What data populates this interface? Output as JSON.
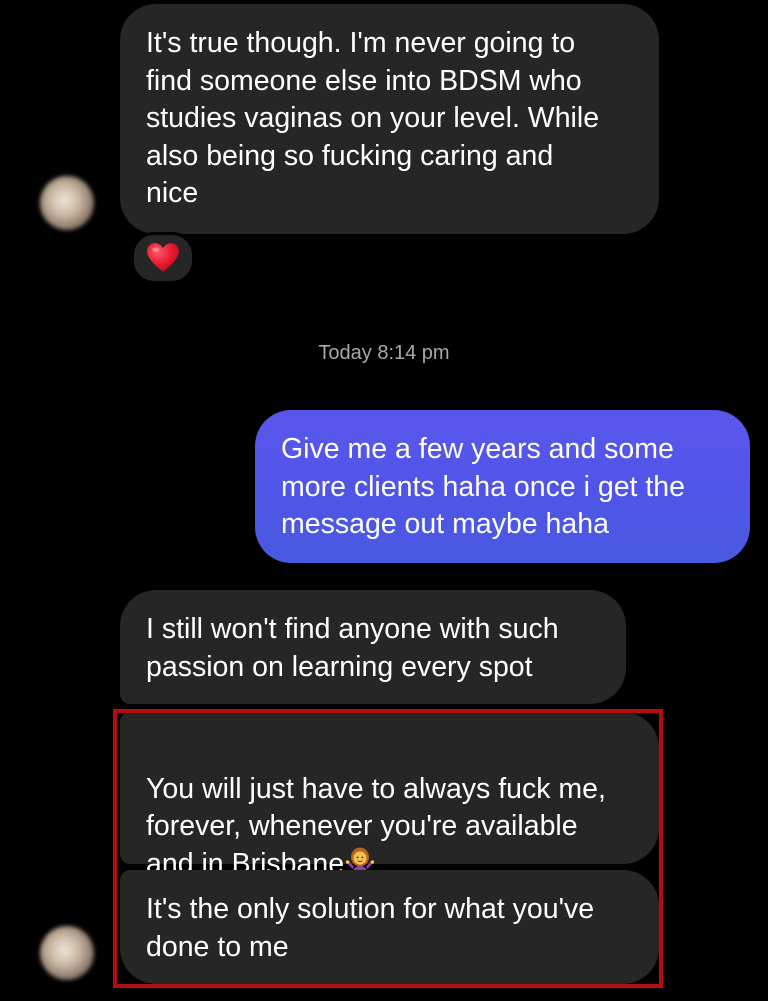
{
  "conversation": {
    "messages": [
      {
        "direction": "incoming",
        "text": "It's true though. I'm never going to\nfind someone else into BDSM who\nstudies vaginas on your level. While\nalso being so fucking caring and\nnice",
        "reaction": "heart"
      },
      {
        "direction": "outgoing",
        "text": "Give me a few years and some\nmore clients haha once i get the\nmessage out maybe haha"
      },
      {
        "direction": "incoming",
        "text": "I still won't find anyone with such\npassion on learning every spot"
      },
      {
        "direction": "incoming",
        "text": "You will just have to always fuck me,\nforever, whenever you're available\nand in Brisbane",
        "emoji": "person-shrugging-emoji"
      },
      {
        "direction": "incoming",
        "text": "It's the only solution for what you've\ndone to me"
      }
    ],
    "timestamp": "Today 8:14 pm"
  },
  "colors": {
    "background": "#000000",
    "incoming_bubble": "#262626",
    "outgoing_gradient_top": "#5a56ec",
    "outgoing_gradient_bottom": "#4a5ae0",
    "timestamp_text": "#a8a8a8",
    "reaction_heart": "#e8192c",
    "highlight_annotation": "#b30d0d"
  },
  "icons": {
    "avatar": "blurred-profile-avatar",
    "reaction": "red-heart-icon",
    "emoji": "person-shrugging-emoji"
  }
}
